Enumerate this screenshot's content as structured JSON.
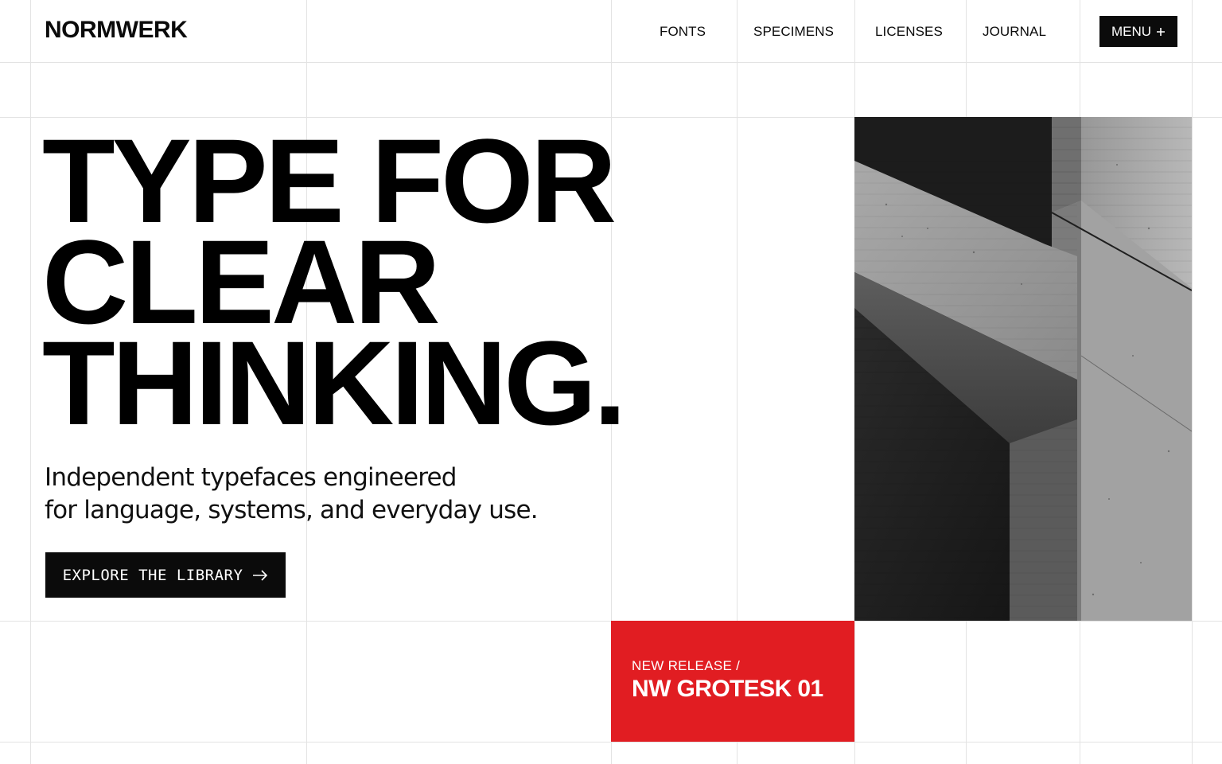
{
  "brand": {
    "name": "NORMWERK"
  },
  "nav": {
    "items": [
      {
        "label": "FONTS"
      },
      {
        "label": "SPECIMENS"
      },
      {
        "label": "LICENSES"
      },
      {
        "label": "JOURNAL"
      }
    ],
    "menu_label": "MENU",
    "menu_icon": "plus-icon"
  },
  "hero": {
    "headline": [
      "TYPE FOR",
      "CLEAR",
      "THINKING."
    ],
    "subtext": [
      "Independent typefaces engineered",
      "for language, systems, and everyday use."
    ],
    "cta_label": "EXPLORE THE LIBRARY",
    "cta_icon": "arrow-right-icon",
    "image": "concrete-architecture-photo"
  },
  "release": {
    "eyebrow": "NEW RELEASE /",
    "title": "NW GROTESK 01"
  },
  "colors": {
    "accent": "#e11d22",
    "ink": "#0b0b0b",
    "background": "#ffffff",
    "grid": "#e3e3e3"
  }
}
